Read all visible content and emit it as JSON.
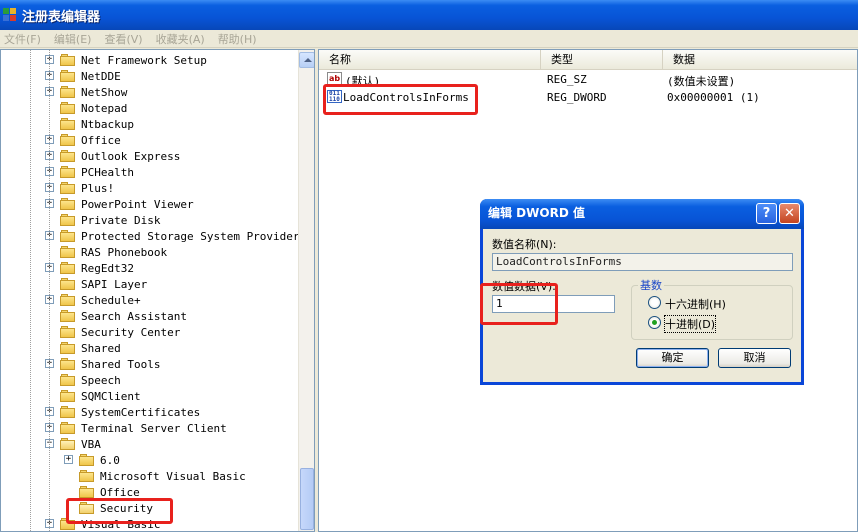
{
  "window": {
    "title": "注册表编辑器"
  },
  "menu": [
    {
      "label": "文件(F)"
    },
    {
      "label": "编辑(E)"
    },
    {
      "label": "查看(V)"
    },
    {
      "label": "收藏夹(A)"
    },
    {
      "label": "帮助(H)"
    }
  ],
  "tree": {
    "items": [
      {
        "label": "Net Framework Setup",
        "expander": "+"
      },
      {
        "label": "NetDDE",
        "expander": "+"
      },
      {
        "label": "NetShow",
        "expander": "+"
      },
      {
        "label": "Notepad",
        "expander": ""
      },
      {
        "label": "Ntbackup",
        "expander": ""
      },
      {
        "label": "Office",
        "expander": "+"
      },
      {
        "label": "Outlook Express",
        "expander": "+"
      },
      {
        "label": "PCHealth",
        "expander": "+"
      },
      {
        "label": "Plus!",
        "expander": "+"
      },
      {
        "label": "PowerPoint Viewer",
        "expander": "+"
      },
      {
        "label": "Private Disk",
        "expander": ""
      },
      {
        "label": "Protected Storage System Provider",
        "expander": "+"
      },
      {
        "label": "RAS Phonebook",
        "expander": ""
      },
      {
        "label": "RegEdt32",
        "expander": "+"
      },
      {
        "label": "SAPI Layer",
        "expander": ""
      },
      {
        "label": "Schedule+",
        "expander": "+"
      },
      {
        "label": "Search Assistant",
        "expander": ""
      },
      {
        "label": "Security Center",
        "expander": ""
      },
      {
        "label": "Shared",
        "expander": ""
      },
      {
        "label": "Shared Tools",
        "expander": "+"
      },
      {
        "label": "Speech",
        "expander": ""
      },
      {
        "label": "SQMClient",
        "expander": ""
      },
      {
        "label": "SystemCertificates",
        "expander": "+"
      },
      {
        "label": "Terminal Server Client",
        "expander": "+"
      },
      {
        "label": "VBA",
        "expander": "-"
      },
      {
        "label": "6.0",
        "expander": "+"
      },
      {
        "label": "Microsoft Visual Basic",
        "expander": ""
      },
      {
        "label": "Office",
        "expander": ""
      },
      {
        "label": "Security",
        "expander": ""
      },
      {
        "label": "Visual Basic",
        "expander": "+"
      }
    ]
  },
  "list": {
    "columns": [
      "名称",
      "类型",
      "数据"
    ],
    "rows": [
      {
        "icon": "string-value-icon",
        "name": "(默认)",
        "type": "REG_SZ",
        "data": "(数值未设置)"
      },
      {
        "icon": "binary-value-icon",
        "name": "LoadControlsInForms",
        "type": "REG_DWORD",
        "data": "0x00000001 (1)"
      }
    ]
  },
  "dialog": {
    "title": "编辑 DWORD 值",
    "name_label": "数值名称(N):",
    "name_value": "LoadControlsInForms",
    "data_label": "数值数据(V):",
    "data_value": "1",
    "base_label": "基数",
    "radio_hex": "十六进制(H)",
    "radio_dec": "十进制(D)",
    "selected_base": "decimal",
    "ok": "确定",
    "cancel": "取消"
  },
  "colors": {
    "highlight": "#e8211d",
    "titlebar": "#0A5FE0",
    "dialog_border": "#0A46D8"
  }
}
